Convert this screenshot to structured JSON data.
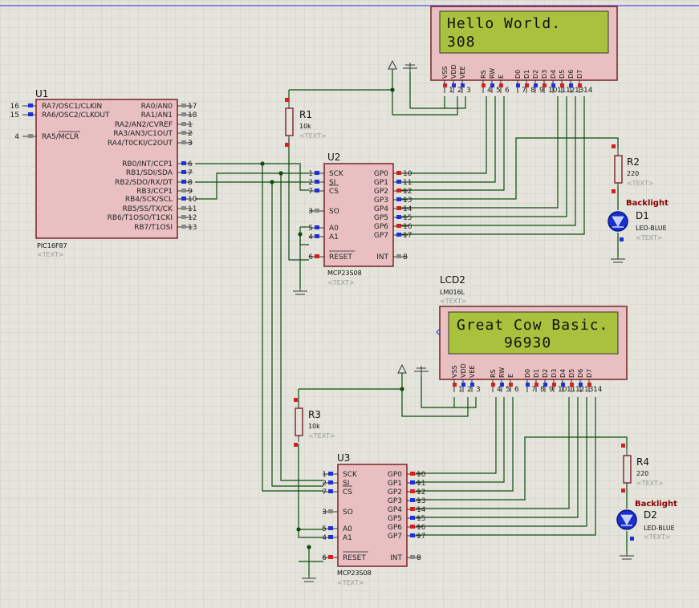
{
  "u1": {
    "ref": "U1",
    "part": "PIC16F87",
    "text": "<TEXT>",
    "left_pins": [
      {
        "num": "16",
        "name": "RA7/OSC1/CLKIN"
      },
      {
        "num": "15",
        "name": "RA6/OSC2/CLKOUT"
      },
      {
        "num": "4",
        "name": "RA5/MCLR"
      }
    ],
    "right_pins": [
      {
        "num": "17",
        "name": "RA0/AN0"
      },
      {
        "num": "18",
        "name": "RA1/AN1"
      },
      {
        "num": "1",
        "name": "RA2/AN2/CVREF"
      },
      {
        "num": "2",
        "name": "RA3/AN3/C1OUT"
      },
      {
        "num": "3",
        "name": "RA4/T0CKI/C2OUT"
      },
      {
        "num": "6",
        "name": "RB0/INT/CCP1"
      },
      {
        "num": "7",
        "name": "RB1/SDI/SDA"
      },
      {
        "num": "8",
        "name": "RB2/SDO/RX/DT"
      },
      {
        "num": "9",
        "name": "RB3/CCP1"
      },
      {
        "num": "10",
        "name": "RB4/SCK/SCL"
      },
      {
        "num": "11",
        "name": "RB5/SS/TX/CK"
      },
      {
        "num": "12",
        "name": "RB6/T1OSO/T1CKI"
      },
      {
        "num": "13",
        "name": "RB7/T1OSI"
      }
    ]
  },
  "u2": {
    "ref": "U2",
    "part": "MCP23S08",
    "text": "<TEXT>",
    "left_pins": [
      {
        "num": "1",
        "name": "SCK"
      },
      {
        "num": "2",
        "name": "SI"
      },
      {
        "num": "7",
        "name": "CS"
      },
      {
        "num": "3",
        "name": "SO"
      },
      {
        "num": "5",
        "name": "A0"
      },
      {
        "num": "4",
        "name": "A1"
      },
      {
        "num": "6",
        "name": "RESET"
      }
    ],
    "right_pins": [
      {
        "num": "10",
        "name": "GP0"
      },
      {
        "num": "11",
        "name": "GP1"
      },
      {
        "num": "12",
        "name": "GP2"
      },
      {
        "num": "13",
        "name": "GP3"
      },
      {
        "num": "14",
        "name": "GP4"
      },
      {
        "num": "15",
        "name": "GP5"
      },
      {
        "num": "16",
        "name": "GP6"
      },
      {
        "num": "17",
        "name": "GP7"
      },
      {
        "num": "8",
        "name": "INT"
      }
    ]
  },
  "u3": {
    "ref": "U3",
    "part": "MCP23S08",
    "text": "<TEXT>"
  },
  "lcd1": {
    "line1": "Hello World.",
    "line2": "308",
    "pin_names": [
      "VSS",
      "VDD",
      "VEE",
      "RS",
      "RW",
      "E",
      "D0",
      "D1",
      "D2",
      "D3",
      "D4",
      "D5",
      "D6",
      "D7"
    ],
    "pin_nums": [
      "1",
      "2",
      "3",
      "4",
      "5",
      "6",
      "7",
      "8",
      "9",
      "10",
      "11",
      "12",
      "13",
      "14"
    ]
  },
  "lcd2": {
    "ref": "LCD2",
    "part": "LM016L",
    "text": "<TEXT>",
    "line1": "Great Cow Basic.",
    "line2": "96930"
  },
  "r1": {
    "ref": "R1",
    "value": "10k",
    "text": "<TEXT>"
  },
  "r2": {
    "ref": "R2",
    "value": "220",
    "text": "<TEXT>"
  },
  "r3": {
    "ref": "R3",
    "value": "10k",
    "text": "<TEXT>"
  },
  "r4": {
    "ref": "R4",
    "value": "220",
    "text": "<TEXT>"
  },
  "d1": {
    "ref": "D1",
    "part": "LED-BLUE",
    "text": "<TEXT>",
    "label": "Backlight"
  },
  "d2": {
    "ref": "D2",
    "part": "LED-BLUE",
    "text": "<TEXT>",
    "label": "Backlight"
  },
  "colors": {
    "background": "#e4e4dc",
    "grid": "#d0d0c6",
    "chip_fill": "#e9c0c2",
    "chip_border": "#7a2226",
    "wire": "#0b4d0b",
    "lcd_screen": "#a9c23d",
    "pin_red": "#d42020",
    "pin_blue": "#2030d8",
    "pin_gray": "#888888",
    "led_blue": "#1a2fd0"
  }
}
